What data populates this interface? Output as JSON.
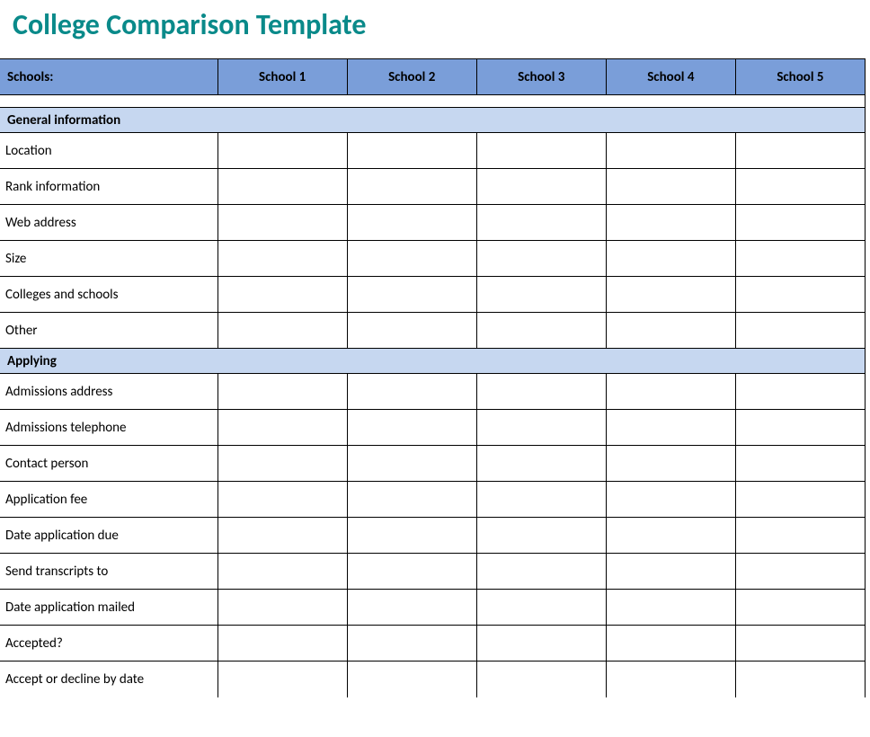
{
  "title": "College Comparison Template",
  "header": {
    "row_label": "Schools:",
    "schools": [
      "School 1",
      "School 2",
      "School 3",
      "School 4",
      "School 5"
    ]
  },
  "sections": [
    {
      "name": "General information",
      "rows": [
        {
          "label": "Location",
          "values": [
            "",
            "",
            "",
            "",
            ""
          ]
        },
        {
          "label": "Rank information",
          "values": [
            "",
            "",
            "",
            "",
            ""
          ]
        },
        {
          "label": "Web address",
          "values": [
            "",
            "",
            "",
            "",
            ""
          ]
        },
        {
          "label": "Size",
          "values": [
            "",
            "",
            "",
            "",
            ""
          ]
        },
        {
          "label": "Colleges and schools",
          "values": [
            "",
            "",
            "",
            "",
            ""
          ]
        },
        {
          "label": "Other",
          "values": [
            "",
            "",
            "",
            "",
            ""
          ]
        }
      ]
    },
    {
      "name": "Applying",
      "rows": [
        {
          "label": "Admissions address",
          "values": [
            "",
            "",
            "",
            "",
            ""
          ]
        },
        {
          "label": "Admissions telephone",
          "values": [
            "",
            "",
            "",
            "",
            ""
          ]
        },
        {
          "label": "Contact person",
          "values": [
            "",
            "",
            "",
            "",
            ""
          ]
        },
        {
          "label": "Application fee",
          "values": [
            "",
            "",
            "",
            "",
            ""
          ]
        },
        {
          "label": "Date application due",
          "values": [
            "",
            "",
            "",
            "",
            ""
          ]
        },
        {
          "label": "Send transcripts to",
          "values": [
            "",
            "",
            "",
            "",
            ""
          ]
        },
        {
          "label": "Date application mailed",
          "values": [
            "",
            "",
            "",
            "",
            ""
          ]
        },
        {
          "label": "Accepted?",
          "values": [
            "",
            "",
            "",
            "",
            ""
          ]
        },
        {
          "label": "Accept or decline by date",
          "values": [
            "",
            "",
            "",
            "",
            ""
          ]
        }
      ]
    }
  ]
}
